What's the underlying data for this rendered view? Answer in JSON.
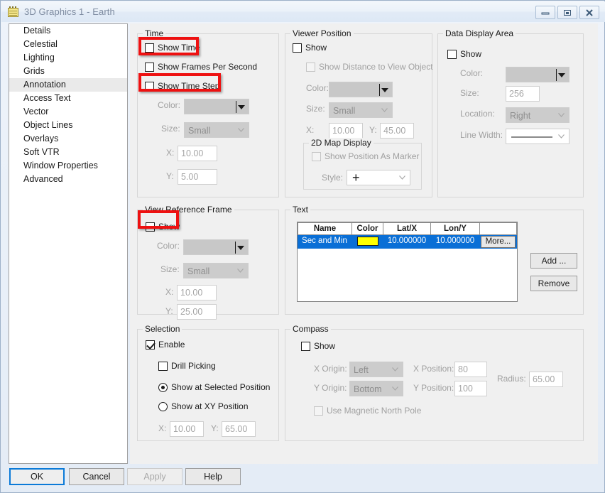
{
  "window": {
    "title": "3D Graphics 1 - Earth",
    "icon": "notepad-icon",
    "minimize": "minimize-icon",
    "restore": "restore-icon",
    "close": "close-icon"
  },
  "sidebar": {
    "items": [
      {
        "label": "Details",
        "selected": false
      },
      {
        "label": "Celestial",
        "selected": false
      },
      {
        "label": "Lighting",
        "selected": false
      },
      {
        "label": "Grids",
        "selected": false
      },
      {
        "label": "Annotation",
        "selected": true
      },
      {
        "label": "Access Text",
        "selected": false
      },
      {
        "label": "Vector",
        "selected": false
      },
      {
        "label": "Object Lines",
        "selected": false
      },
      {
        "label": "Overlays",
        "selected": false
      },
      {
        "label": "Soft VTR",
        "selected": false
      },
      {
        "label": "Window Properties",
        "selected": false
      },
      {
        "label": "Advanced",
        "selected": false
      }
    ]
  },
  "time_group": {
    "caption": "Time",
    "show_time": "Show Time",
    "show_fps": "Show Frames Per Second",
    "show_time_step": "Show Time Step",
    "color_label": "Color:",
    "color_value": "",
    "size_label": "Size:",
    "size_value": "Small",
    "x_label": "X:",
    "x_value": "10.00",
    "y_label": "Y:",
    "y_value": "5.00"
  },
  "viewer_group": {
    "caption": "Viewer Position",
    "show": "Show",
    "show_distance": "Show Distance to View Object",
    "color_label": "Color:",
    "color_value": "",
    "size_label": "Size:",
    "size_value": "Small",
    "x_label": "X:",
    "x_value": "10.00",
    "y_label": "Y:",
    "y_value": "45.00",
    "map_caption": "2D Map Display",
    "show_marker": "Show Position As Marker",
    "style_label": "Style:",
    "style_value": "+"
  },
  "data_display_group": {
    "caption": "Data Display Area",
    "show": "Show",
    "color_label": "Color:",
    "color_value": "",
    "size_label": "Size:",
    "size_value": "256",
    "location_label": "Location:",
    "location_value": "Right",
    "line_width_label": "Line Width:",
    "line_width_value": ""
  },
  "vrf_group": {
    "caption": "View Reference Frame",
    "show": "Show",
    "color_label": "Color:",
    "color_value": "",
    "size_label": "Size:",
    "size_value": "Small",
    "x_label": "X:",
    "x_value": "10.00",
    "y_label": "Y:",
    "y_value": "25.00"
  },
  "text_group": {
    "caption": "Text",
    "columns": [
      "Name",
      "Color",
      "Lat/X",
      "Lon/Y",
      ""
    ],
    "rows": [
      {
        "name": "Sec and Min",
        "color": "#ffff00",
        "lat_x": "10.000000",
        "lon_y": "10.000000",
        "more": "More..."
      }
    ],
    "add_button": "Add ...",
    "remove_button": "Remove"
  },
  "selection_group": {
    "caption": "Selection",
    "enable": "Enable",
    "drill_picking": "Drill Picking",
    "show_at_selected": "Show at Selected Position",
    "show_at_xy": "Show at XY Position",
    "x_label": "X:",
    "x_value": "10.00",
    "y_label": "Y:",
    "y_value": "65.00"
  },
  "compass_group": {
    "caption": "Compass",
    "show": "Show",
    "x_origin_label": "X Origin:",
    "x_origin_value": "Left",
    "y_origin_label": "Y Origin:",
    "y_origin_value": "Bottom",
    "x_position_label": "X Position:",
    "x_position_value": "80",
    "y_position_label": "Y Position:",
    "y_position_value": "100",
    "radius_label": "Radius:",
    "radius_value": "65.00",
    "magnetic_north": "Use Magnetic North Pole"
  },
  "footer": {
    "ok": "OK",
    "cancel": "Cancel",
    "apply": "Apply",
    "help": "Help"
  },
  "colors": {
    "annotation_red": "#ee1111",
    "selection_blue": "#0a6fd6",
    "swatch_yellow": "#ffff00",
    "focus_blue": "#0b7ad8"
  }
}
